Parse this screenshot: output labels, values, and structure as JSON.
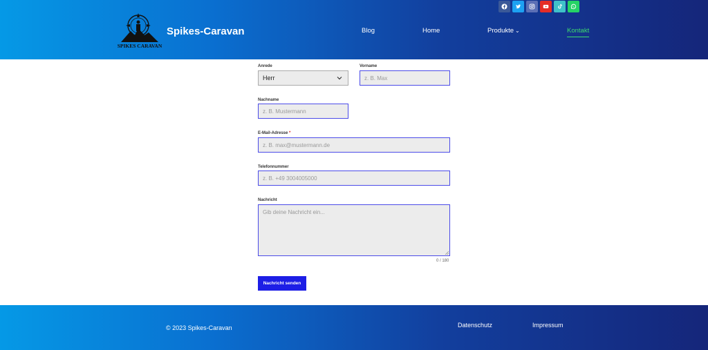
{
  "header": {
    "brand": "Spikes-Caravan",
    "logo_text": "SPIKES CARAVAN",
    "nav": [
      {
        "label": "Blog"
      },
      {
        "label": "Home"
      },
      {
        "label": "Produkte"
      },
      {
        "label": "Kontakt"
      }
    ],
    "social": [
      {
        "icon": "facebook-icon",
        "color": "#3b5998"
      },
      {
        "icon": "twitter-icon",
        "color": "#1da1f2"
      },
      {
        "icon": "instagram-icon",
        "color": "#5b6fb5"
      },
      {
        "icon": "youtube-icon",
        "color": "#e52d27"
      },
      {
        "icon": "tiktok-icon",
        "color": "#3fc1c9"
      },
      {
        "icon": "whatsapp-icon",
        "color": "#25d366"
      }
    ]
  },
  "form": {
    "anrede": {
      "label": "Anrede",
      "value": "Herr"
    },
    "vorname": {
      "label": "Vorname",
      "placeholder": "z. B. Max"
    },
    "nachname": {
      "label": "Nachname",
      "placeholder": "z. B. Mustermann"
    },
    "email": {
      "label": "E-Mail-Adresse",
      "required_mark": "*",
      "placeholder": "z. B. max@mustermann.de"
    },
    "telefon": {
      "label": "Telefonnummer",
      "placeholder": "z. B. +49 3004005000"
    },
    "nachricht": {
      "label": "Nachricht",
      "placeholder": "Gib deine Nachricht ein...",
      "counter": "0 / 180"
    },
    "submit_label": "Nachricht senden"
  },
  "footer": {
    "copyright": "© 2023 Spikes-Caravan",
    "links": [
      {
        "label": "Datenschutz"
      },
      {
        "label": "Impressum"
      }
    ]
  },
  "colors": {
    "accent": "#1d1ee6",
    "active_nav": "#3ddc6e",
    "header_start": "#0599e6",
    "header_end": "#15267a"
  }
}
